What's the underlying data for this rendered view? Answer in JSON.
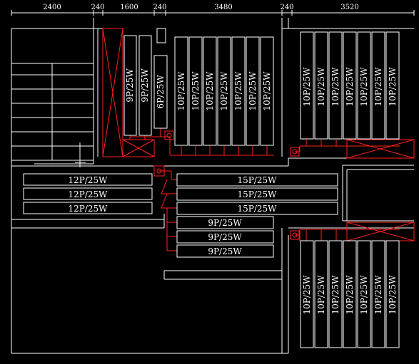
{
  "dimensions": {
    "items": [
      "2400",
      "240",
      "1600",
      "240",
      "3480",
      "240",
      "3520"
    ]
  },
  "fixtures": {
    "top_left_9p": [
      "9P/25W",
      "9P/25W"
    ],
    "top_6p": [
      "6P/25W"
    ],
    "top_middle_10p": [
      "10P/25W",
      "10P/25W",
      "10P/25W",
      "10P/25W",
      "10P/25W",
      "10P/25W",
      "10P/25W"
    ],
    "top_right_10p": [
      "10P/25W",
      "10P/25W",
      "10P/25W",
      "10P/25W",
      "10P/25W",
      "10P/25W",
      "10P/25W"
    ],
    "left_12p": [
      "12P/25W",
      "12P/25W",
      "12P/25W"
    ],
    "middle_15p": [
      "15P/25W",
      "15P/25W",
      "15P/25W"
    ],
    "middle_9p": [
      "9P/25W",
      "9P/25W",
      "9P/25W"
    ],
    "bottom_right_10p": [
      "10P/25W",
      "10P/25W",
      "10P/25W",
      "10P/25W",
      "10P/25W",
      "10P/25W",
      "10P/25W"
    ]
  },
  "colors": {
    "background": "#000000",
    "wall": "#ffffff",
    "wire": "#ff2020"
  }
}
